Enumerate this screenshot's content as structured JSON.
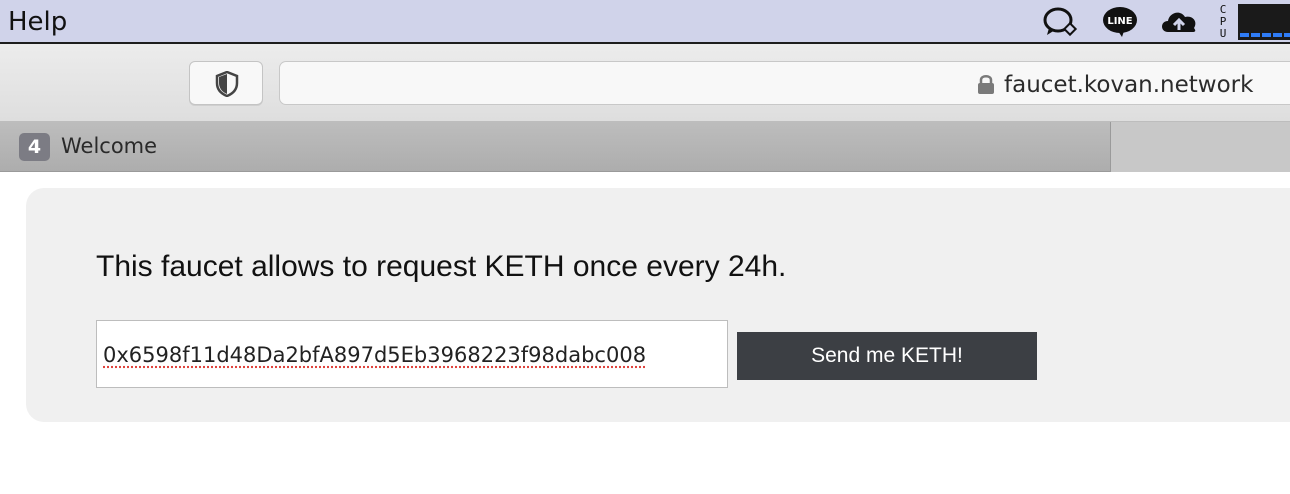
{
  "menubar": {
    "help_label": "Help",
    "tray_icons": [
      "chat-bubble-icon",
      "line-icon",
      "cloud-upload-icon",
      "cpu-monitor-icon"
    ],
    "cpu_label": "CPU"
  },
  "browser": {
    "address": "faucet.kovan.network",
    "tab": {
      "count": "4",
      "title": "Welcome"
    }
  },
  "page": {
    "headline": "This faucet allows to request KETH once every 24h.",
    "address_input_value": "0x6598f11d48Da2bfA897d5Eb3968223f98dabc008",
    "send_button_label": "Send me KETH!"
  },
  "colors": {
    "menubar_bg": "#d0d3ea",
    "button_bg": "#3c3f44",
    "cpu_graph": "#2f7cf6"
  }
}
